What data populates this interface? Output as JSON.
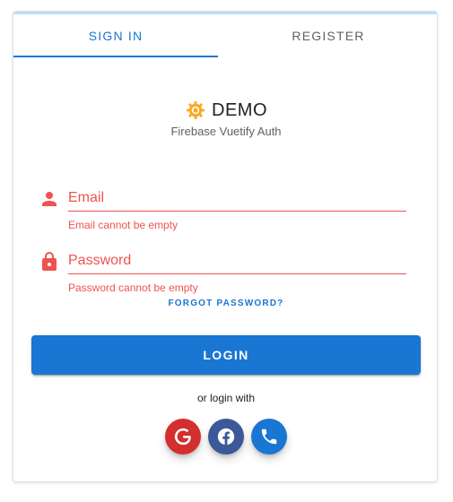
{
  "tabs": [
    {
      "label": "SIGN IN",
      "active": true
    },
    {
      "label": "REGISTER",
      "active": false
    }
  ],
  "brand": {
    "title": "DEMO",
    "subtitle": "Firebase Vuetify Auth",
    "icon": "sun-gear-icon"
  },
  "form": {
    "email": {
      "placeholder": "Email",
      "value": "",
      "error": "Email cannot be empty",
      "icon": "person-icon"
    },
    "password": {
      "placeholder": "Password",
      "value": "",
      "error": "Password cannot be empty",
      "icon": "lock-icon"
    },
    "forgot_label": "FORGOT PASSWORD?",
    "login_label": "LOGIN"
  },
  "alt_login": {
    "label": "or login with",
    "providers": [
      {
        "name": "google",
        "icon": "google-icon",
        "color": "#d32f2f"
      },
      {
        "name": "facebook",
        "icon": "facebook-icon",
        "color": "#3b5998"
      },
      {
        "name": "phone",
        "icon": "phone-icon",
        "color": "#1976d2"
      }
    ]
  },
  "colors": {
    "primary": "#1976d2",
    "error": "#ef5350",
    "brand_icon": "#f9a825"
  }
}
